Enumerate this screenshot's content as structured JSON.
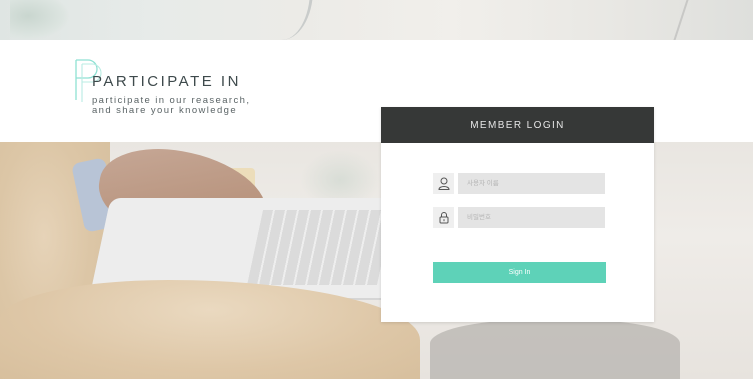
{
  "brand": {
    "title": "PARTICIPATE IN",
    "tagline": "participate in our reasearch,\nand share your knowledge",
    "accent_color": "#5ed2b8"
  },
  "login": {
    "header": "MEMBER LOGIN",
    "username": {
      "placeholder": "사용자 이름",
      "icon": "user-icon"
    },
    "password": {
      "placeholder": "비밀번호",
      "icon": "lock-icon"
    },
    "submit_label": "Sign In"
  }
}
